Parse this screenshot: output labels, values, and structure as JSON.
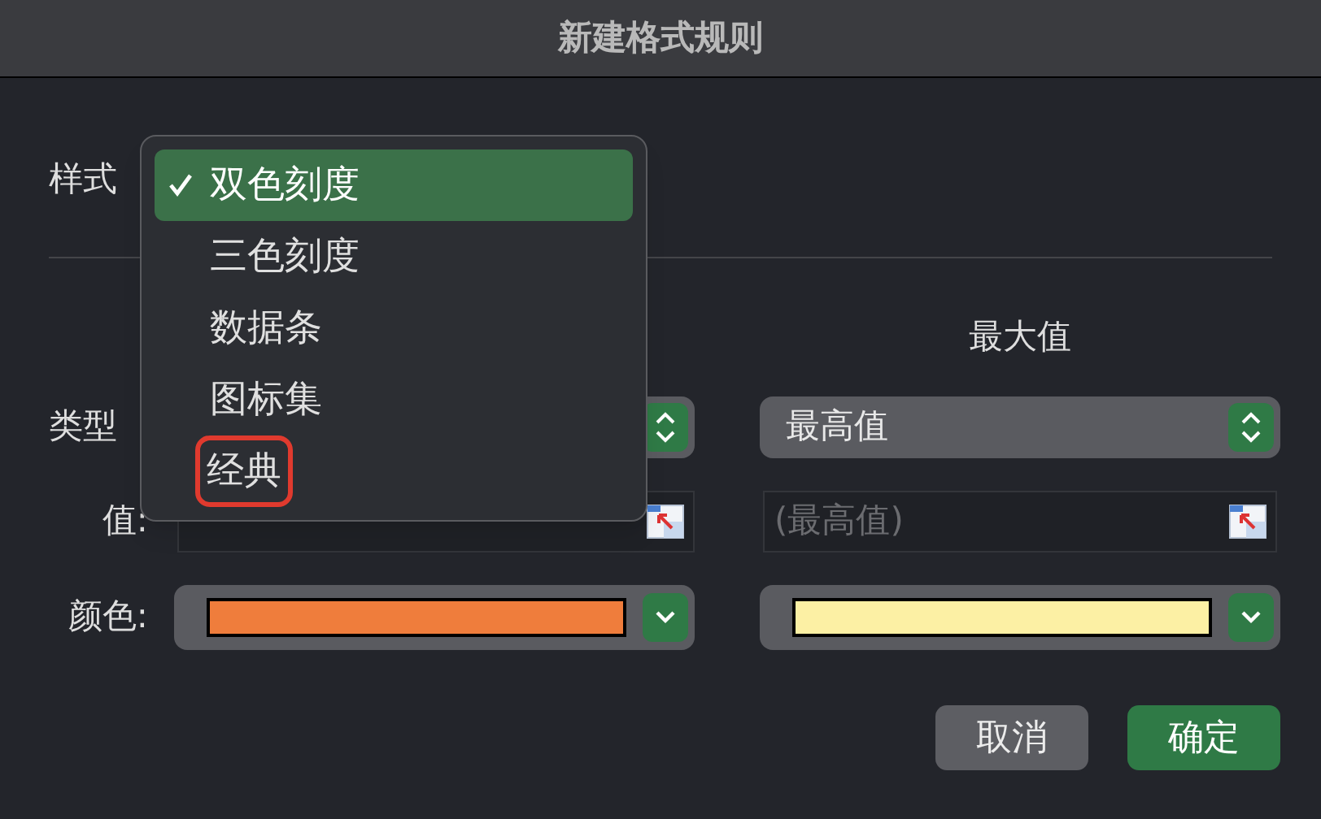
{
  "window": {
    "title": "新建格式规则"
  },
  "style_label": "样式",
  "style_menu": [
    {
      "label": "双色刻度",
      "selected": true,
      "annotated": false
    },
    {
      "label": "三色刻度",
      "selected": false,
      "annotated": false
    },
    {
      "label": "数据条",
      "selected": false,
      "annotated": false
    },
    {
      "label": "图标集",
      "selected": false,
      "annotated": false
    },
    {
      "label": "经典",
      "selected": false,
      "annotated": true
    }
  ],
  "row_labels": [
    "类型",
    "值:",
    "颜色:"
  ],
  "columns": [
    {
      "color": "#ef7d3c"
    },
    {
      "header": "最大值",
      "type": "最高值",
      "value_placeholder": "(最高值)",
      "color": "#fcf0a4"
    }
  ],
  "buttons": [
    {
      "label": "取消",
      "kind": "cancel"
    },
    {
      "label": "确定",
      "kind": "primary"
    }
  ]
}
